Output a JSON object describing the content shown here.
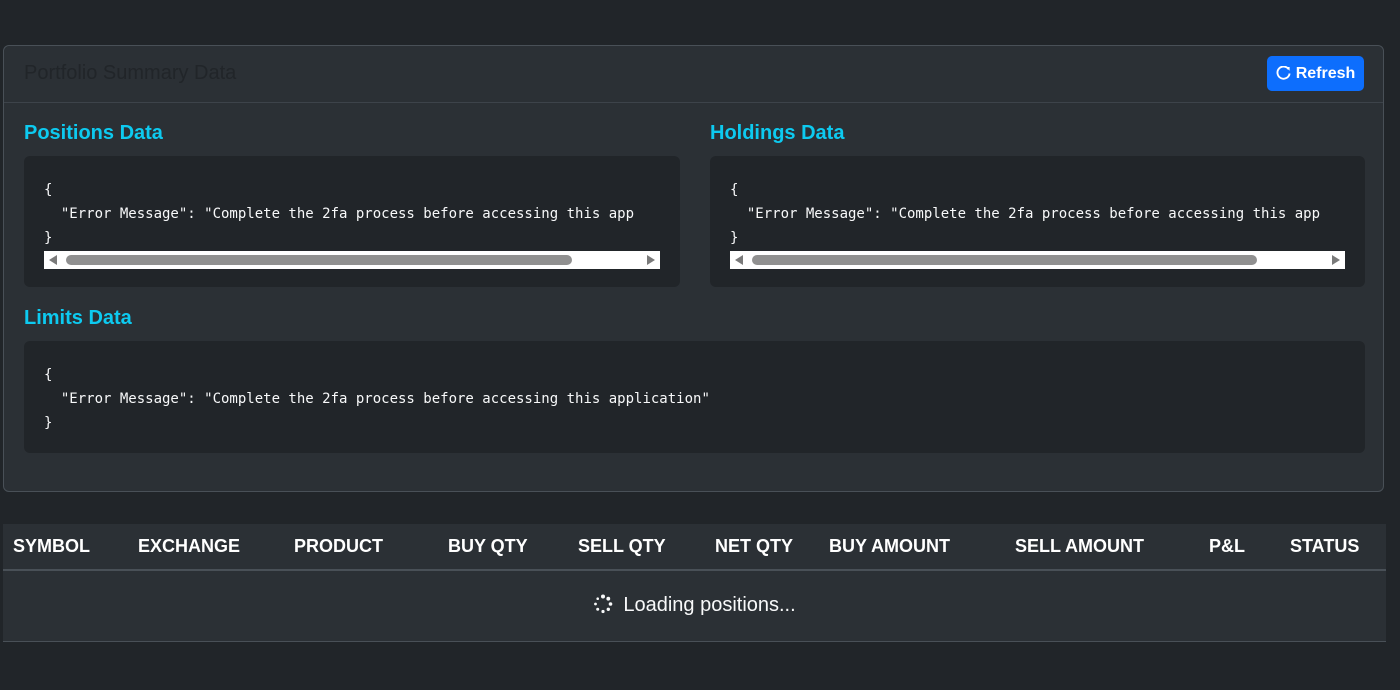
{
  "card": {
    "title": "Portfolio Summary Data",
    "refresh_label": "Refresh"
  },
  "sections": {
    "positions": {
      "title": "Positions Data",
      "json": "{\n  \"Error Message\": \"Complete the 2fa process before accessing this app\n}"
    },
    "holdings": {
      "title": "Holdings Data",
      "json": "{\n  \"Error Message\": \"Complete the 2fa process before accessing this app\n}"
    },
    "limits": {
      "title": "Limits Data",
      "json": "{\n  \"Error Message\": \"Complete the 2fa process before accessing this application\"\n}"
    }
  },
  "table": {
    "columns": [
      "SYMBOL",
      "EXCHANGE",
      "PRODUCT",
      "BUY QTY",
      "SELL QTY",
      "NET QTY",
      "BUY AMOUNT",
      "SELL AMOUNT",
      "P&L",
      "STATUS"
    ],
    "loading_text": "Loading positions..."
  },
  "icons": {
    "refresh": "refresh-icon",
    "spinner": "spinner-icon"
  },
  "colors": {
    "background": "#212529",
    "card": "#2b3035",
    "accent": "#0dcaf0",
    "primary": "#0d6efd"
  }
}
